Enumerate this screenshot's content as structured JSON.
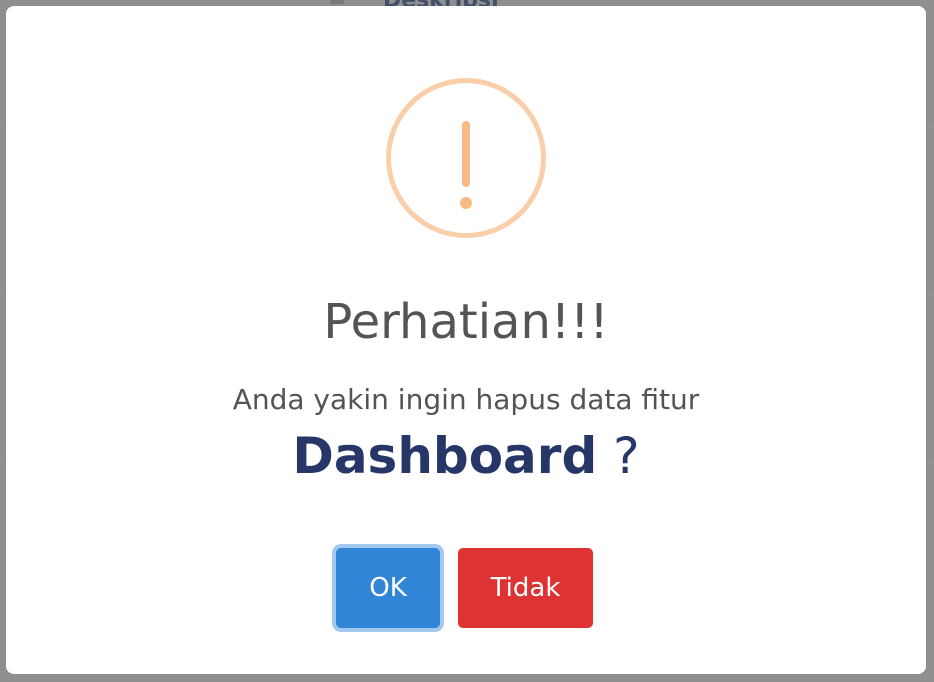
{
  "background": {
    "heading_partial": "Deskripsi"
  },
  "dialog": {
    "icon": "warning-exclamation-icon",
    "title": "Perhatian!!!",
    "message": "Anda yakin ingin hapus data fitur",
    "feature_name": "Dashboard",
    "question_mark": " ?",
    "confirm_label": "OK",
    "cancel_label": "Tidak"
  },
  "colors": {
    "icon": "#facea8",
    "confirm": "#3085d6",
    "cancel": "#dd3333",
    "feature_text": "#253667"
  }
}
